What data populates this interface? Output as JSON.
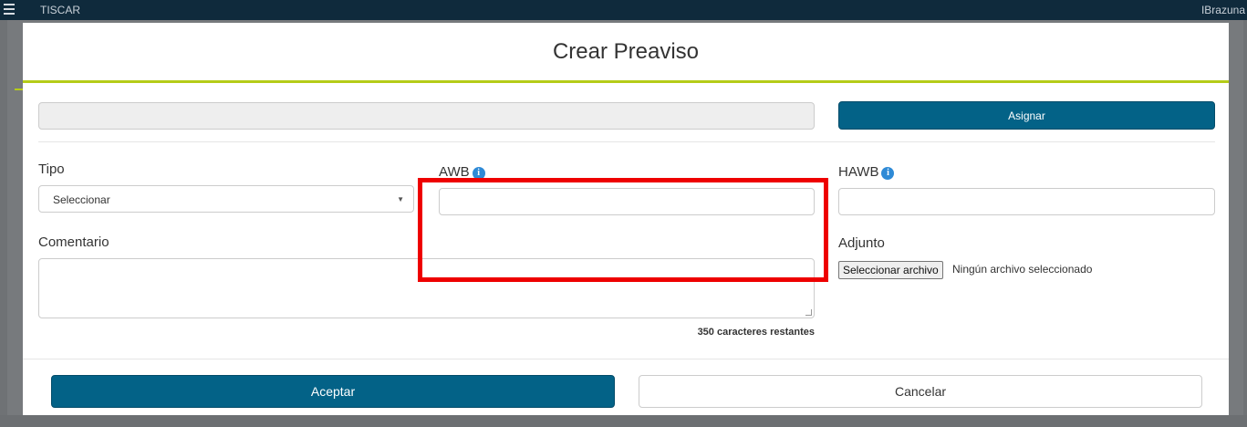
{
  "background": {
    "app_title": "TISCAR",
    "user_name": "IBrazuna"
  },
  "modal": {
    "title": "Crear Preaviso",
    "assign_button": "Asignar",
    "tipo": {
      "label": "Tipo",
      "selected": "Seleccionar"
    },
    "awb": {
      "label": "AWB",
      "value": ""
    },
    "hawb": {
      "label": "HAWB",
      "value": ""
    },
    "comentario": {
      "label": "Comentario",
      "chars_remaining": "350 caracteres restantes"
    },
    "adjunto": {
      "label": "Adjunto",
      "button": "Seleccionar archivo",
      "status": "Ningún archivo seleccionado"
    },
    "accept_button": "Aceptar",
    "cancel_button": "Cancelar"
  },
  "colors": {
    "primary": "#036287",
    "accent_line": "#b5cc18",
    "highlight": "#ee0000",
    "info_icon": "#2e8ad6"
  }
}
